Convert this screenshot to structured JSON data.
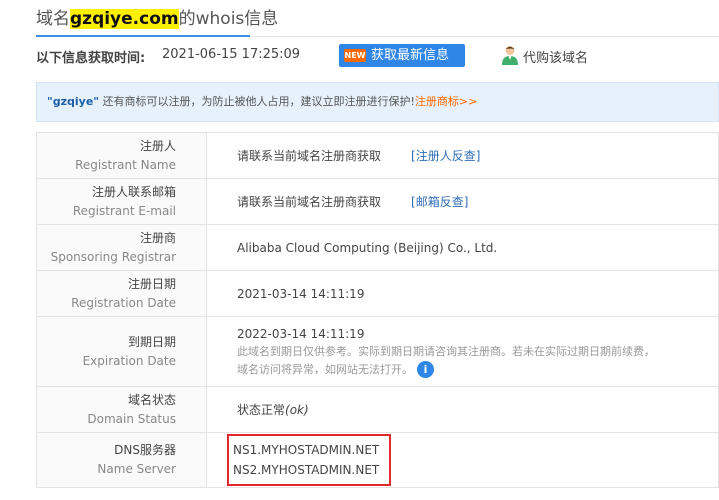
{
  "header": {
    "prefix": "域名",
    "domain": "gzqiye.com",
    "suffix": "的whois信息"
  },
  "info": {
    "fetch_label": "以下信息获取时间:",
    "fetch_time": "2021-06-15 17:25:09",
    "new_badge": "NEW",
    "refresh_label": "获取最新信息",
    "buy_label": "代购该域名"
  },
  "notice": {
    "keyword": "\"gzqiye\"",
    "text": " 还有商标可以注册，为防止被他人占用，建议立即注册进行保护!",
    "link": "注册商标>>"
  },
  "rows": {
    "registrant": {
      "cn": "注册人",
      "en": "Registrant Name",
      "value": "请联系当前域名注册商获取",
      "link": "[注册人反查]"
    },
    "email": {
      "cn": "注册人联系邮箱",
      "en": "Registrant E-mail",
      "value": "请联系当前域名注册商获取",
      "link": "[邮箱反查]"
    },
    "registrar": {
      "cn": "注册商",
      "en": "Sponsoring Registrar",
      "value": "Alibaba Cloud Computing (Beijing) Co., Ltd."
    },
    "reg_date": {
      "cn": "注册日期",
      "en": "Registration Date",
      "value": "2021-03-14 14:11:19"
    },
    "exp_date": {
      "cn": "到期日期",
      "en": "Expiration Date",
      "value": "2022-03-14 14:11:19",
      "note1": "此域名到期日仅供参考。实际到期日期请咨询其注册商。若未在实际过期日期前续费，",
      "note2": "域名访问将异常，如网站无法打开。"
    },
    "status": {
      "cn": "域名状态",
      "en": "Domain Status",
      "value": "状态正常",
      "code": "(ok)"
    },
    "dns": {
      "cn": "DNS服务器",
      "en": "Name Server",
      "ns1": "NS1.MYHOSTADMIN.NET",
      "ns2": "NS2.MYHOSTADMIN.NET"
    }
  },
  "colors": {
    "accent": "#2f86e6",
    "highlight": "#ffef00",
    "link": "#ff6600",
    "box": "#e0282d"
  }
}
